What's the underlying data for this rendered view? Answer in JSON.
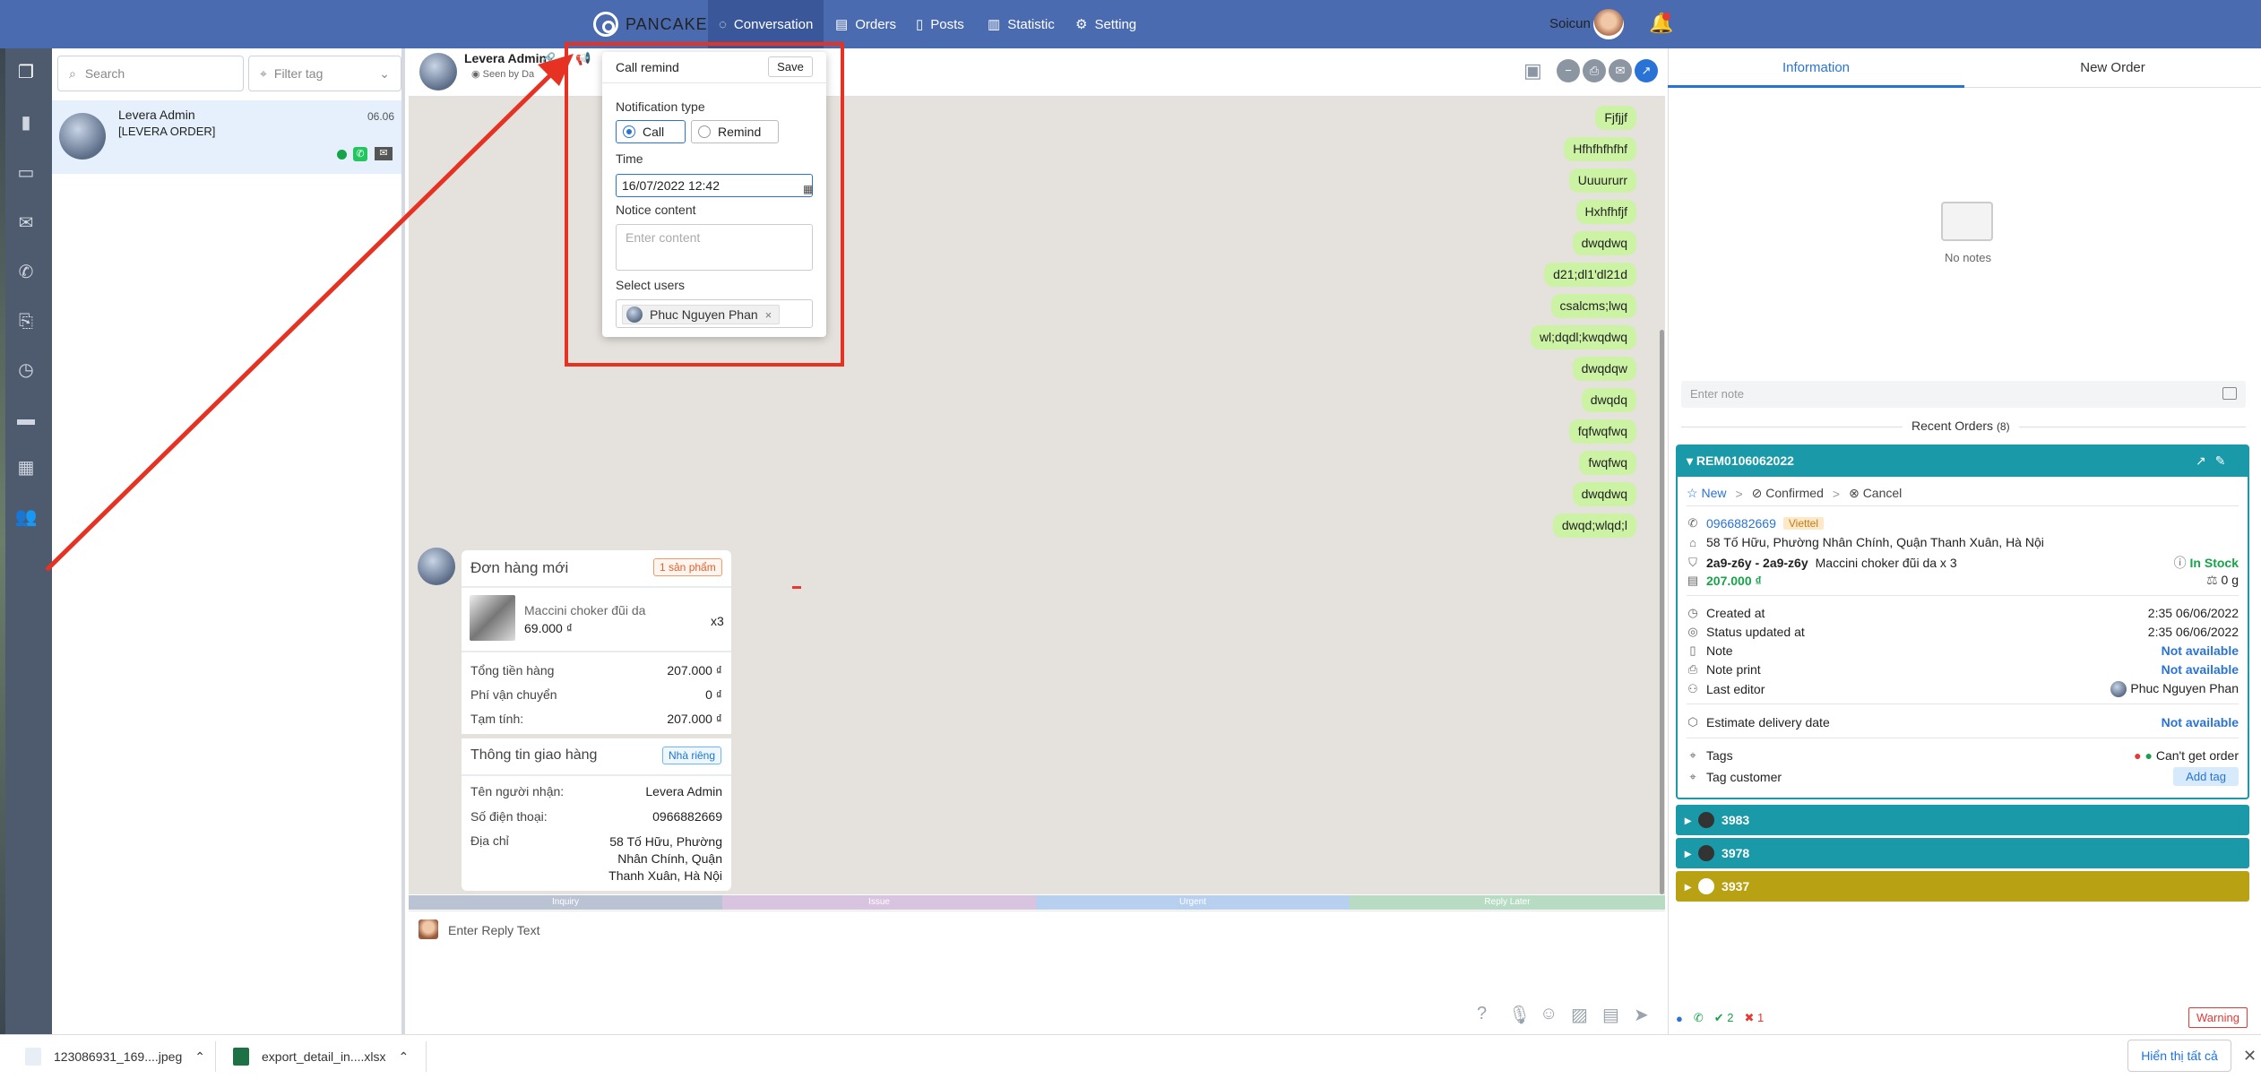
{
  "topbar": {
    "brand": "PANCAKE",
    "nav": [
      "Conversation",
      "Orders",
      "Posts",
      "Statistic",
      "Setting"
    ],
    "user": "Soicun"
  },
  "sidebar": {
    "search_placeholder": "Search",
    "filter_placeholder": "Filter tag",
    "conversation": {
      "name": "Levera Admin",
      "message": "[LEVERA ORDER]",
      "date": "06.06"
    }
  },
  "chat": {
    "name": "Levera Admin",
    "seen": "Seen by Da",
    "messages": [
      "Fjfjjf",
      "Hfhfhfhfhf",
      "Uuuururr",
      "Hxhfhfjf",
      "dwqdwq",
      "d21;dl1'dl21d",
      "csalcms;lwq",
      "wl;dqdl;kwqdwq",
      "dwqdqw",
      "dwqdq",
      "fqfwqfwq",
      "fwqfwq",
      "dwqdwq",
      "dwqd;wlqd;l"
    ],
    "order_card": {
      "title": "Đơn hàng mới",
      "badge": "1 sản phẩm",
      "product": "Maccini choker đũi da",
      "price": "69.000 ₫",
      "qty": "x3",
      "rows": [
        [
          "Tổng tiền hàng",
          "207.000 ₫"
        ],
        [
          "Phí vận chuyển",
          "0 ₫"
        ],
        [
          "Tạm tính:",
          "207.000 ₫"
        ]
      ],
      "ship_title": "Thông tin giao hàng",
      "ship_badge": "Nhà riêng",
      "ship_rows": [
        [
          "Tên người nhận:",
          "Levera Admin"
        ],
        [
          "Số điện thoại:",
          "0966882669"
        ]
      ],
      "address_label": "Địa chỉ",
      "address": [
        "58 Tố Hữu, Phường",
        "Nhân Chính, Quận",
        "Thanh Xuân, Hà Nội"
      ]
    },
    "tags": [
      "Inquiry",
      "Issue",
      "Urgent",
      "Reply Later"
    ],
    "reply_placeholder": "Enter Reply Text"
  },
  "popup": {
    "title": "Call remind",
    "save": "Save",
    "notification_label": "Notification type",
    "opt_call": "Call",
    "opt_remind": "Remind",
    "time_label": "Time",
    "time_value": "16/07/2022 12:42",
    "content_label": "Notice content",
    "content_placeholder": "Enter content",
    "users_label": "Select users",
    "user": "Phuc Nguyen Phan"
  },
  "right": {
    "tab_info": "Information",
    "tab_new": "New Order",
    "no_notes": "No notes",
    "note_placeholder": "Enter note",
    "recent_orders": "Recent Orders",
    "recent_count": "(8)",
    "order": {
      "id": "REM0106062022",
      "status": [
        "New",
        "Confirmed",
        "Cancel"
      ],
      "phone": "0966882669",
      "carrier": "Viettel",
      "address": "58 Tố Hữu, Phường Nhân Chính, Quận Thanh Xuân, Hà Nội",
      "sku": "2a9-z6y - 2a9-z6y",
      "product": "Maccini choker đũi da x 3",
      "stock": "In Stock",
      "total": "207.000 ₫",
      "weight": "0 g",
      "created_label": "Created at",
      "created": "2:35 06/06/2022",
      "updated_label": "Status updated at",
      "updated": "2:35 06/06/2022",
      "note_label": "Note",
      "note": "Not available",
      "noteprint_label": "Note print",
      "noteprint": "Not available",
      "editor_label": "Last editor",
      "editor": "Phuc Nguyen Phan",
      "delivery_label": "Estimate delivery date",
      "delivery": "Not available",
      "tags_label": "Tags",
      "tags": "Can't get order",
      "tagcust_label": "Tag customer",
      "add_tag": "Add tag"
    },
    "sub_orders": [
      "3983",
      "3978",
      "3937"
    ],
    "footer": {
      "ok": "2",
      "err": "1",
      "warning": "Warning"
    }
  },
  "downloads": {
    "items": [
      "123086931_169....jpeg",
      "export_detail_in....xlsx"
    ],
    "show_all": "Hiển thị tất cả"
  },
  "colors": {
    "topbar": "#4a6bb0",
    "teal": "#1a9aa8",
    "olive": "#b8a214",
    "bubble": "#ccf2a4",
    "annotation": "#e53222"
  }
}
